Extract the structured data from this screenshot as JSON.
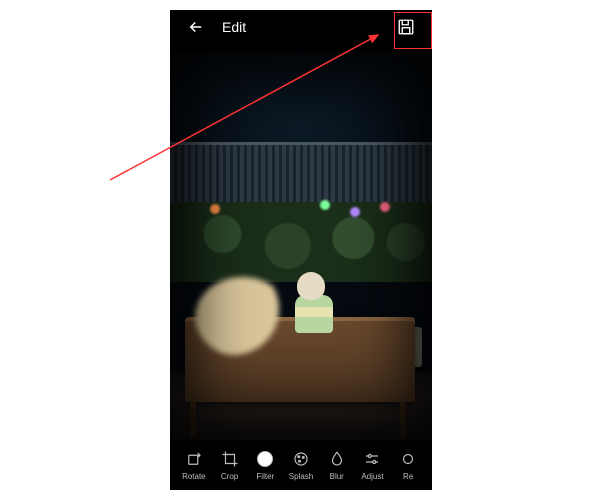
{
  "header": {
    "title": "Edit"
  },
  "tools": [
    {
      "label": "Rotate"
    },
    {
      "label": "Crop"
    },
    {
      "label": "Filter"
    },
    {
      "label": "Splash"
    },
    {
      "label": "Blur"
    },
    {
      "label": "Adjust"
    },
    {
      "label": "Re"
    }
  ],
  "annotation": {
    "highlight_color": "#ff3333"
  }
}
